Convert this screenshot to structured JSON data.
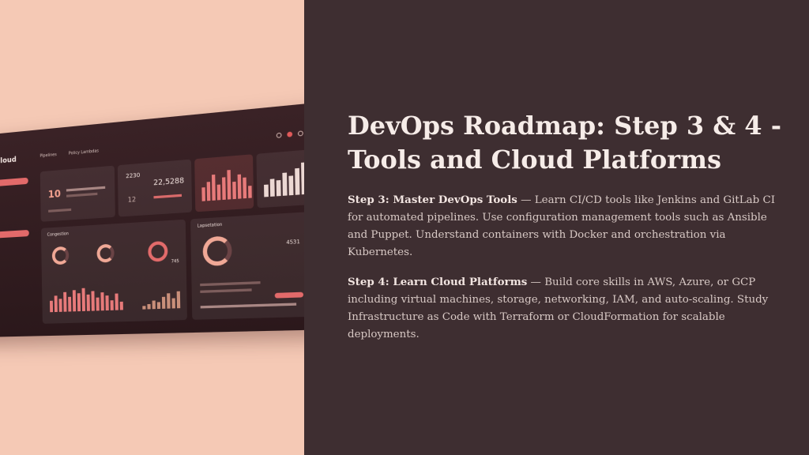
{
  "slide": {
    "title": "DevOps Roadmap: Step 3 & 4 - Tools and Cloud Platforms",
    "step3": {
      "heading": "Step 3: Master DevOps Tools",
      "body": " — Learn CI/CD tools like Jenkins and GitLab CI for automated pipelines. Use configuration management tools such as Ansible and Puppet. Understand containers with Docker and orchestration via Kubernetes."
    },
    "step4": {
      "heading": "Step 4: Learn Cloud Platforms",
      "body": " — Build core skills in AWS, Azure, or GCP including virtual machines, storage, networking, IAM, and auto-scaling. Study Infrastructure as Code with Terraform or CloudFormation for scalable deployments."
    }
  },
  "dashboard": {
    "brand": "Cloud",
    "topbar": [
      "Pipelines",
      "Policy Lambdas"
    ],
    "stats": {
      "count": "10",
      "value_a": "2230",
      "value_b": "22,5288",
      "value_c": "12"
    },
    "panel_left_title": "Congestion",
    "panel_right_title": "Lapsetation",
    "ring_value": "4531",
    "ring_value_b": "745"
  },
  "colors": {
    "left_bg": "#f5c9b5",
    "right_bg": "#3e2e31",
    "accent": "#e26a6a"
  }
}
